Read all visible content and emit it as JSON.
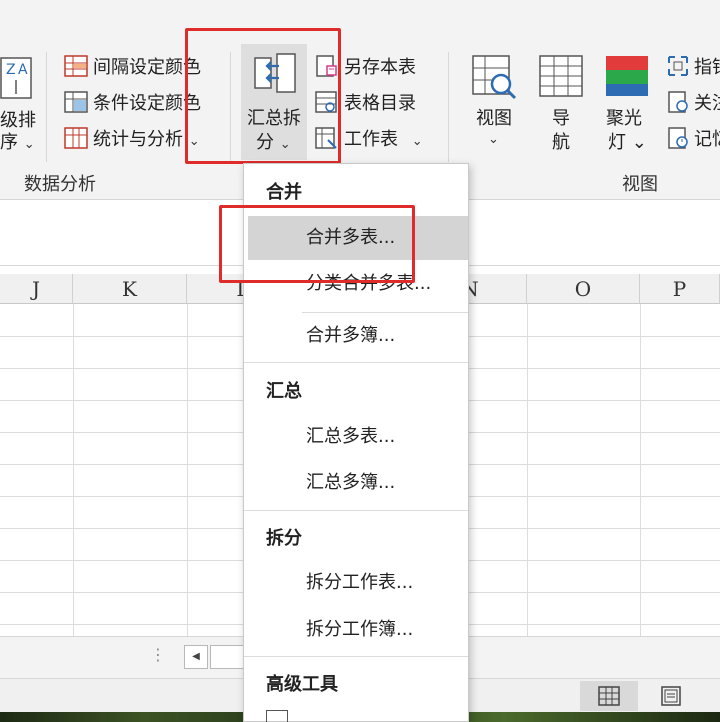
{
  "ribbon": {
    "left_cut": {
      "line1": "级排",
      "line2": "序",
      "chev": "⌄"
    },
    "data_analysis": {
      "items": [
        {
          "label": "间隔设定颜色",
          "icon": "interval-color-icon"
        },
        {
          "label": "条件设定颜色",
          "icon": "condition-color-icon"
        },
        {
          "label": "统计与分析",
          "icon": "statistics-icon",
          "chev": "⌄"
        }
      ],
      "group_label": "数据分析"
    },
    "summary_split": {
      "line1": "汇总拆",
      "line2": "分",
      "chev": "⌄",
      "icon": "merge-arrows-icon"
    },
    "sheet_tools": [
      {
        "label": "另存本表",
        "icon": "save-sheet-icon"
      },
      {
        "label": "表格目录",
        "icon": "table-directory-icon"
      },
      {
        "label": "工作表",
        "icon": "worksheet-icon",
        "chev": "⌄"
      }
    ],
    "view_group": {
      "buttons": [
        {
          "line1": "视图",
          "line2": "⌄",
          "icon": "view-magnifier-icon"
        },
        {
          "line1": "导",
          "line2": "航",
          "icon": "navigation-grid-icon"
        },
        {
          "line1": "聚光",
          "line2": "灯 ⌄",
          "icon": "spotlight-icon"
        }
      ],
      "group_label": "视图",
      "right_cut": [
        {
          "label": "指针"
        },
        {
          "label": "关注"
        },
        {
          "label": "记忆"
        }
      ]
    }
  },
  "columns": [
    "J",
    "K",
    "L",
    "N",
    "O",
    "P"
  ],
  "menu": {
    "sections": [
      {
        "header": "合并",
        "items": [
          "合并多表...",
          "分类合并多表...",
          "合并多簿..."
        ]
      },
      {
        "header": "汇总",
        "items": [
          "汇总多表...",
          "汇总多簿..."
        ]
      },
      {
        "header": "拆分",
        "items": [
          "拆分工作表...",
          "拆分工作簿..."
        ]
      },
      {
        "header": "高级工具",
        "items": []
      }
    ],
    "highlighted": "合并多表..."
  },
  "scrollbar": {
    "left_arrow": "◀",
    "dots": "⋮"
  },
  "colors": {
    "highlight": "#e02b2b",
    "menu_hover": "#d4d4d4",
    "ribbon_bg": "#f3f3f3"
  }
}
